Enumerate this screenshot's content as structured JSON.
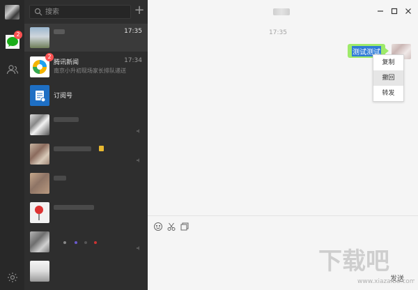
{
  "search": {
    "placeholder": "搜索"
  },
  "nav": {
    "unread_count": "2"
  },
  "conversations": [
    {
      "title": "",
      "subtitle": "",
      "time": "17:35",
      "active": true
    },
    {
      "title": "腾讯新闻",
      "subtitle": "南京小升初现场家长排队递送",
      "time": "17:34",
      "badge": "2"
    },
    {
      "title": "订阅号",
      "subtitle": "",
      "time": ""
    },
    {
      "title": "",
      "subtitle": "",
      "time": ""
    },
    {
      "title": "",
      "subtitle": "",
      "time": ""
    },
    {
      "title": "",
      "subtitle": "",
      "time": ""
    },
    {
      "title": "",
      "subtitle": "",
      "time": ""
    },
    {
      "title": "",
      "subtitle": "",
      "time": ""
    },
    {
      "title": "",
      "subtitle": "",
      "time": ""
    }
  ],
  "chat": {
    "title": "",
    "time_divider": "17:35",
    "message": "测试测试",
    "send_label": "发送"
  },
  "context_menu": [
    "复制",
    "撤回",
    "转发"
  ],
  "watermark": "下载吧 www.xiazaiba.com",
  "colors": {
    "rail_bg": "#282828",
    "list_bg": "#2e2e2e",
    "bubble": "#9eea6a",
    "badge": "#fa5151",
    "chat_bg": "#f5f5f5"
  }
}
